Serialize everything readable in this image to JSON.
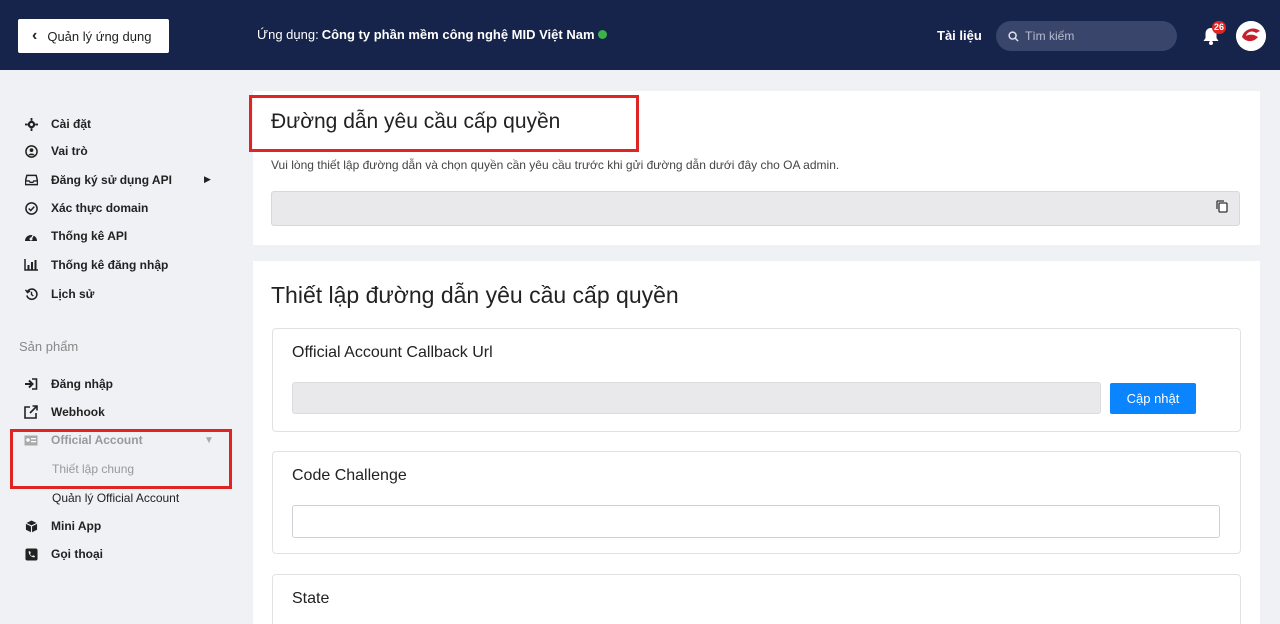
{
  "header": {
    "back_label": "Quản lý ứng dụng",
    "app_prefix": "Ứng dụng:",
    "app_name": "Công ty phần mềm công nghệ MID Việt Nam",
    "docs_label": "Tài liệu",
    "search_placeholder": "Tìm kiếm",
    "notification_count": "26",
    "status_color": "#3ab34a",
    "bar_color": "#16234a"
  },
  "sidebar": {
    "items": [
      {
        "label": "Cài đặt",
        "icon": "gear-icon"
      },
      {
        "label": "Vai trò",
        "icon": "user-circle-icon"
      },
      {
        "label": "Đăng ký sử dụng API",
        "icon": "inbox-icon"
      },
      {
        "label": "Xác thực domain",
        "icon": "check-circle-icon"
      },
      {
        "label": "Thống kê API",
        "icon": "dashboard-icon"
      },
      {
        "label": "Thống kê đăng nhập",
        "icon": "bar-chart-icon"
      },
      {
        "label": "Lịch sử",
        "icon": "history-icon"
      }
    ],
    "section_title": "Sản phẩm",
    "products": [
      {
        "label": "Đăng nhập",
        "icon": "sign-in-icon"
      },
      {
        "label": "Webhook",
        "icon": "external-link-icon"
      },
      {
        "label": "Official Account",
        "icon": "id-card-icon"
      }
    ],
    "official_sub": [
      "Thiết lập chung",
      "Quản lý Official Account"
    ],
    "more": [
      {
        "label": "Mini App",
        "icon": "cube-icon"
      },
      {
        "label": "Gọi thoại",
        "icon": "phone-icon"
      }
    ]
  },
  "main": {
    "title": "Đường dẫn yêu cầu cấp quyền",
    "description": "Vui lòng thiết lập đường dẫn và chọn quyền cần yêu cầu trước khi gửi đường dẫn dưới đây cho OA admin.",
    "url_value": "",
    "setup_title": "Thiết lập đường dẫn yêu cầu cấp quyền",
    "callback_label": "Official Account Callback Url",
    "callback_value": "",
    "update_label": "Cập nhật",
    "code_challenge_label": "Code Challenge",
    "code_challenge_value": "",
    "state_label": "State",
    "accent_color": "#0a84ff",
    "highlight_color": "#e02424"
  }
}
